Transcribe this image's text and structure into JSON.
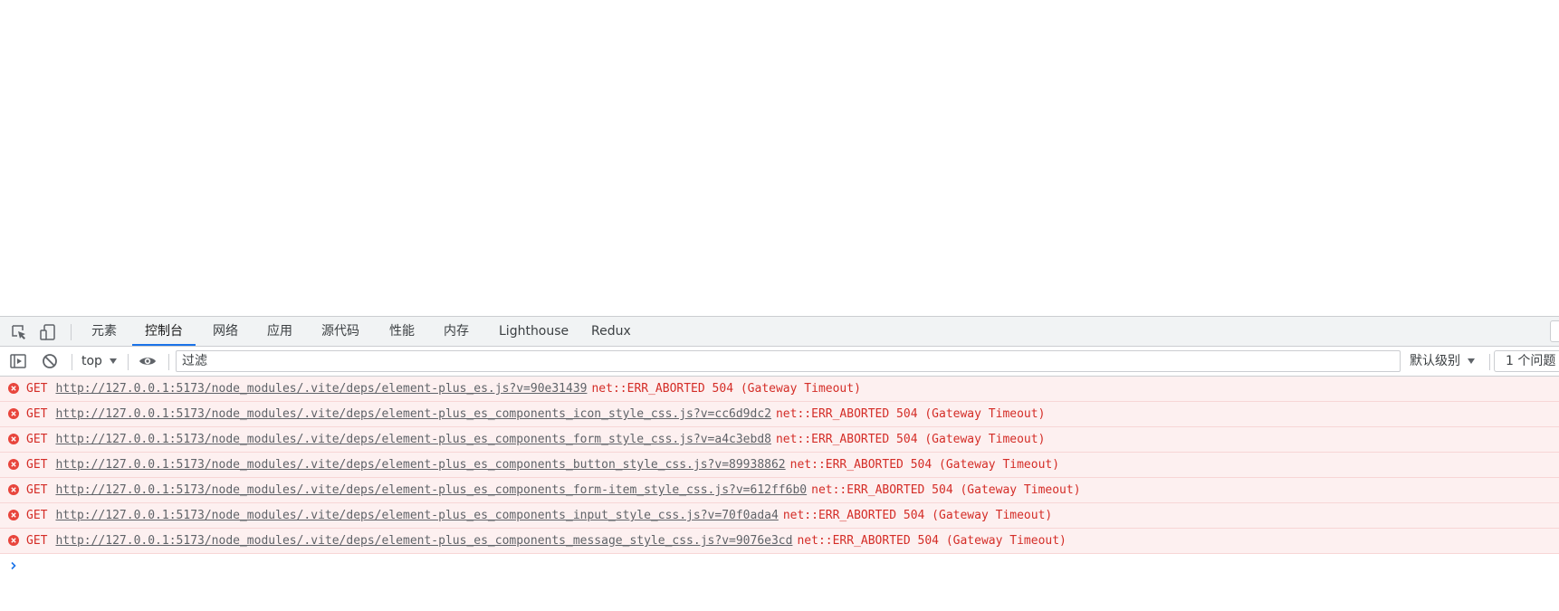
{
  "tabbar": {
    "tabs": [
      {
        "label": "元素"
      },
      {
        "label": "控制台"
      },
      {
        "label": "网络"
      },
      {
        "label": "应用"
      },
      {
        "label": "源代码"
      },
      {
        "label": "性能"
      },
      {
        "label": "内存"
      },
      {
        "label": "Lighthouse"
      },
      {
        "label": "Redux"
      }
    ],
    "active_tab": "控制台"
  },
  "console_toolbar": {
    "context": "top",
    "filter_placeholder": "过滤",
    "levels_label": "默认级别",
    "issues_label": "1 个问题"
  },
  "messages": [
    {
      "method": "GET",
      "url": "http://127.0.0.1:5173/node_modules/.vite/deps/element-plus_es.js?v=90e31439",
      "error": "net::ERR_ABORTED 504 (Gateway Timeout)"
    },
    {
      "method": "GET",
      "url": "http://127.0.0.1:5173/node_modules/.vite/deps/element-plus_es_components_icon_style_css.js?v=cc6d9dc2",
      "error": "net::ERR_ABORTED 504 (Gateway Timeout)"
    },
    {
      "method": "GET",
      "url": "http://127.0.0.1:5173/node_modules/.vite/deps/element-plus_es_components_form_style_css.js?v=a4c3ebd8",
      "error": "net::ERR_ABORTED 504 (Gateway Timeout)"
    },
    {
      "method": "GET",
      "url": "http://127.0.0.1:5173/node_modules/.vite/deps/element-plus_es_components_button_style_css.js?v=89938862",
      "error": "net::ERR_ABORTED 504 (Gateway Timeout)"
    },
    {
      "method": "GET",
      "url": "http://127.0.0.1:5173/node_modules/.vite/deps/element-plus_es_components_form-item_style_css.js?v=612ff6b0",
      "error": "net::ERR_ABORTED 504 (Gateway Timeout)"
    },
    {
      "method": "GET",
      "url": "http://127.0.0.1:5173/node_modules/.vite/deps/element-plus_es_components_input_style_css.js?v=70f0ada4",
      "error": "net::ERR_ABORTED 504 (Gateway Timeout)"
    },
    {
      "method": "GET",
      "url": "http://127.0.0.1:5173/node_modules/.vite/deps/element-plus_es_components_message_style_css.js?v=9076e3cd",
      "error": "net::ERR_ABORTED 504 (Gateway Timeout)"
    }
  ],
  "colors": {
    "accent": "#1a73e8",
    "error_text": "#d42d27",
    "error_bg": "#fdf0f0"
  }
}
